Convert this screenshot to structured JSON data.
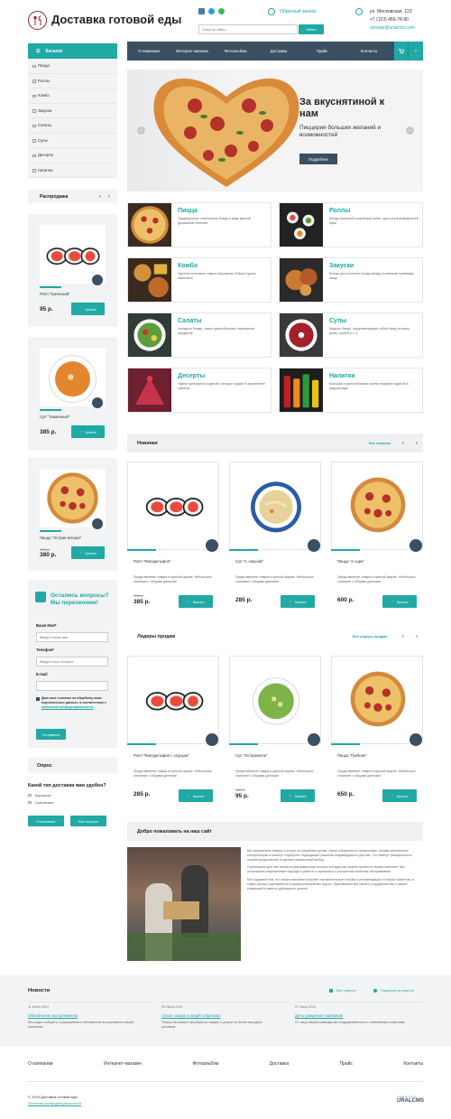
{
  "site": {
    "title": "Доставка готовой еды",
    "search_placeholder": "Поиск по сайту...",
    "search_button": "Найти",
    "callback": "Обратный звонок",
    "address": "ул. Московская, 123",
    "phone": "+7 (123) 456-78-90",
    "email": "noreply@uralcms.com"
  },
  "catalog": {
    "title": "Каталог",
    "items": [
      "Пицца",
      "Роллы",
      "Комбо",
      "Закуски",
      "Салаты",
      "Супы",
      "Десерты",
      "Напитки"
    ]
  },
  "nav": [
    "О компании",
    "Интернет-магазин",
    "Фотоальбом",
    "Доставка",
    "Прайс",
    "Контакты"
  ],
  "slider": {
    "title": "За вкуснятиной к нам",
    "subtitle": "Пиццерия больших желаний и возможностей",
    "button": "Подробнее"
  },
  "sale": {
    "title": "Распродажа",
    "buy": "Купить",
    "items": [
      {
        "name": "Ролл \"Греческий\"",
        "price": "95 р.",
        "old": ""
      },
      {
        "name": "Суп \"Тыквенный\"",
        "price": "385 р.",
        "old": ""
      },
      {
        "name": "Пицца \"Острая мясная\"",
        "price": "380 р.",
        "old": "450 р."
      }
    ]
  },
  "categories": [
    {
      "title": "Пицца",
      "desc": "Традиционное итальянское блюдо в виде круглой дрожжевой лепешки"
    },
    {
      "title": "Роллы",
      "desc": "Блюдо японской и корейской кухни, одна из разновидностей суши"
    },
    {
      "title": "Комбо",
      "desc": "Удачное сочетание самых популярных блюд в одном комплекте"
    },
    {
      "title": "Закуски",
      "desc": "Блюда для утоления голода между основными приёмами пищи"
    },
    {
      "title": "Салаты",
      "desc": "Холодное блюдо, смесь разнообразных нарезанных продуктов"
    },
    {
      "title": "Супы",
      "desc": "Жидкое блюдо, представляющее собой отвар из мяса, рыбы, грибов и т. п."
    },
    {
      "title": "Десерты",
      "desc": "Группа кулинарных изделий, которые подают в заключение трапезы"
    },
    {
      "title": "Напитки",
      "desc": "Большая и разнообразная группа пищевых изделий в жидком виде"
    }
  ],
  "novelties": {
    "title": "Новинки",
    "all": "Все новинки",
    "buy": "Купить",
    "desc": "Представление товара в краткой форме. Небольшое описание с общими данными",
    "items": [
      {
        "name": "Ролл \"Филадельфия\"",
        "price": "385 р.",
        "old": "450 р."
      },
      {
        "name": "Суп \"С лапшой\"",
        "price": "285 р.",
        "old": ""
      },
      {
        "name": "Пицца \"4 сыра\"",
        "price": "600 р.",
        "old": ""
      }
    ]
  },
  "leaders": {
    "title": "Лидеры продаж",
    "all": "Все лидеры продаж",
    "buy": "Купить",
    "desc": "Представление товара в краткой форме. Небольшое описание с общими данными",
    "items": [
      {
        "name": "Ролл \"Филадельфия с огурцом\"",
        "price": "285 р.",
        "old": ""
      },
      {
        "name": "Суп \"Из брокколи\"",
        "price": "95 р.",
        "old": "110 р."
      },
      {
        "name": "Пицца \"Грибная\"",
        "price": "650 р.",
        "old": ""
      }
    ]
  },
  "form": {
    "title": "Остались вопросы? Мы перезвоним!",
    "name_label": "Ваше Имя*",
    "name_ph": "Введите ваше имя",
    "phone_label": "Телефон*",
    "phone_ph": "Введите ваш телефон",
    "email_label": "E-mail",
    "consent": "Даю свое согласие на обработку моих персональных данных, в соответствии с",
    "policy": "политикой конфиденциальности",
    "submit": "Отправить"
  },
  "poll": {
    "title": "Опрос",
    "question": "Какой тип доставки вам удобен?",
    "options": [
      "Курьером",
      "Самовывоз"
    ],
    "vote": "Голосовать",
    "all": "Все опросы"
  },
  "welcome": {
    "title": "Добро пожаловать на наш сайт",
    "p1": "Мы предлагаем товары и услуги по разумным ценам. Наши специалисты предоставят профессиональную консультацию и помогут подобрать подходящее решение индивидуально для вас. Он помогут разобраться в нашем предложении и сделать правильный выбор.",
    "p2": "Ориентиром для нас является максимальная польза, которую мы можем принести своим клиентам. Мы используем современные подходы к работе и стремимся к улучшению качества обслуживания.",
    "p3": "Мы гордимся тем, что наша компания получает положительные отзывы и рекомендации от наших клиентов, а также хорошо оценивается в профессиональных кругах. Приглашаем вас начать сотрудничество с нашей компанией и вместе добиваться успеха!"
  },
  "news": {
    "title": "Новости",
    "all": "Все новости",
    "subscribe": "Подписка на новости",
    "items": [
      {
        "date": "11 Июля 2024",
        "title": "Обновление ассортимента",
        "text": "Мы рады сообщить о расширении и обновлении ассортимента нашей компании."
      },
      {
        "date": "09 Июля 2024",
        "title": "Сезон скидок и акций стартовал",
        "text": "Теперь вы можете приобрести товары и услуги на более выгодных условиях."
      },
      {
        "date": "07 Июля 2024",
        "title": "День рождения компании!",
        "text": "От лица нашей команды мы поздравляем всех с отмечаемым событием."
      }
    ]
  },
  "footer": {
    "copyright": "© 2024 Доставка готовой еды",
    "policy": "Политика конфиденциальности",
    "made": "создание сайтов",
    "brand": "URALCMS"
  },
  "colors": {
    "accent": "#20a9a5",
    "dark": "#3b4f63",
    "nav": "#3b4f63"
  }
}
